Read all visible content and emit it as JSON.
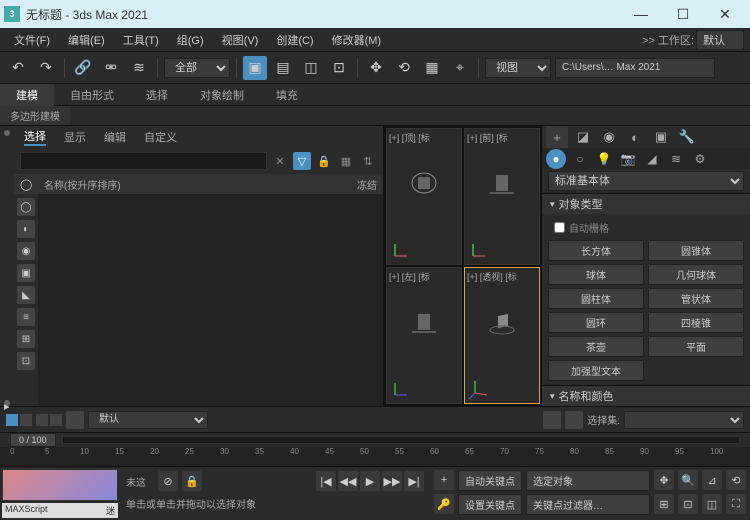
{
  "title": "无标题 - 3ds Max 2021",
  "menubar": [
    "文件(F)",
    "编辑(E)",
    "工具(T)",
    "组(G)",
    "视图(V)",
    "创建(C)",
    "修改器(M)"
  ],
  "workspace": {
    "label": ">> 工作区:",
    "value": "默认"
  },
  "toolbar": {
    "scope": "全部",
    "view": "视图",
    "path": "C:\\Users\\… Max 2021"
  },
  "ribbon": [
    "建模",
    "自由形式",
    "选择",
    "对象绘制",
    "填充"
  ],
  "subribbon": "多边形建模",
  "scene": {
    "tabs": [
      "选择",
      "显示",
      "编辑",
      "自定义"
    ],
    "col1": "名称(按升序排序)",
    "col2": "冻结"
  },
  "viewports": {
    "tl": "[+] [顶] [标",
    "tr": "[+] [前] [标",
    "bl": "[+] [左] [标",
    "br": "[+] [透视] [标"
  },
  "cmd": {
    "category": "标准基本体",
    "roll1": "对象类型",
    "autogrid": "自动栅格",
    "btns": [
      [
        "长方体",
        "圆锥体"
      ],
      [
        "球体",
        "几何球体"
      ],
      [
        "圆柱体",
        "管状体"
      ],
      [
        "圆环",
        "四棱锥"
      ],
      [
        "茶壶",
        "平面"
      ],
      [
        "加强型文本",
        ""
      ]
    ],
    "roll2": "名称和颜色"
  },
  "layerbar": {
    "layer": "默认",
    "selset": "选择集:"
  },
  "timeline": {
    "indicator": "0 / 100",
    "ticks": [
      0,
      5,
      10,
      15,
      20,
      25,
      30,
      35,
      40,
      45,
      50,
      55,
      60,
      65,
      70,
      75,
      80,
      85,
      90,
      95,
      100
    ]
  },
  "status": {
    "mxlabel": "MAXScript",
    "mxmini": "迷",
    "untitled": "未这",
    "prompt": "单击或单击并拖动以选择对象",
    "autokey": "自动关键点",
    "selkey": "选定对象",
    "setkey": "设置关键点",
    "keyfilter": "关键点过滤器…"
  }
}
